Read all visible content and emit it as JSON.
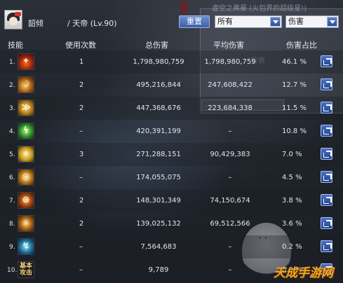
{
  "background": {
    "panel_text": "虚空之弗曼 (火包界的超级星!)",
    "sub_text": "秒表",
    "button_text": "..."
  },
  "header": {
    "player_name": "韶倾",
    "player_class": "/ 天帝 (Lv.90)",
    "reset_label": "重置",
    "filter_value": "所有",
    "sort_value": "伤害"
  },
  "table": {
    "columns": [
      "技能",
      "使用次数",
      "总伤害",
      "平均伤害",
      "伤害占比"
    ],
    "rows": [
      {
        "rank": "1.",
        "icon": "flame-skill-icon",
        "uses": "1",
        "total": "1,798,980,759",
        "avg": "1,798,980,759",
        "pct": "46.1 %"
      },
      {
        "rank": "2.",
        "icon": "claw-skill-icon",
        "uses": "2",
        "total": "495,216,844",
        "avg": "247,608,422",
        "pct": "12.7 %"
      },
      {
        "rank": "3.",
        "icon": "slash-skill-icon",
        "uses": "2",
        "total": "447,368,676",
        "avg": "223,684,338",
        "pct": "11.5 %"
      },
      {
        "rank": "4.",
        "icon": "lightning-skill-icon",
        "uses": "–",
        "total": "420,391,199",
        "avg": "–",
        "pct": "10.8 %"
      },
      {
        "rank": "5.",
        "icon": "star-skill-icon",
        "uses": "3",
        "total": "271,288,151",
        "avg": "90,429,383",
        "pct": "7.0 %"
      },
      {
        "rank": "6.",
        "icon": "orb-skill-icon",
        "uses": "–",
        "total": "174,055,075",
        "avg": "–",
        "pct": "4.5 %"
      },
      {
        "rank": "7.",
        "icon": "rune-skill-icon",
        "uses": "2",
        "total": "148,301,349",
        "avg": "74,150,674",
        "pct": "3.8 %"
      },
      {
        "rank": "8.",
        "icon": "sun-skill-icon",
        "uses": "2",
        "total": "139,025,132",
        "avg": "69,512,566",
        "pct": "3.6 %"
      },
      {
        "rank": "9.",
        "icon": "blue-skill-icon",
        "uses": "–",
        "total": "7,564,683",
        "avg": "–",
        "pct": "0.2 %"
      },
      {
        "rank": "10.",
        "icon": "basic-attack-icon",
        "uses": "–",
        "total": "9,789",
        "avg": "–",
        "pct": "0.0 %"
      }
    ],
    "basic_icon_text": "基本\n攻击"
  },
  "watermark": "天成手游网",
  "colors": {
    "accent_button": "#3d5fa8",
    "watermark": "#f6a623"
  }
}
